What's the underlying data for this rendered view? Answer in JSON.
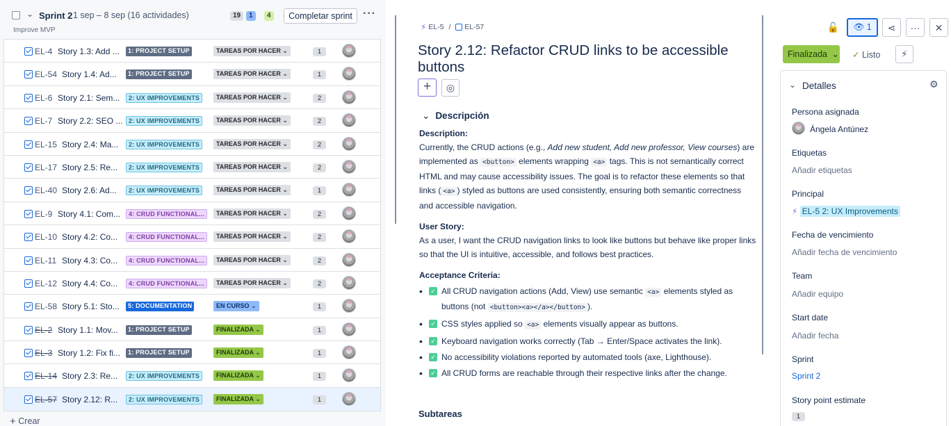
{
  "sprint": {
    "name": "Sprint 2",
    "dates": "1 sep – 8 sep (16 actividades)",
    "goal": "Improve MVP",
    "counts": {
      "todo": "19",
      "in_progress": "1",
      "done": "4"
    },
    "complete_label": "Completar sprint",
    "more": "···"
  },
  "issues": [
    {
      "key": "EL-4",
      "title": "Story 1.3: Add ...",
      "epic": "1: PROJECT SETUP",
      "epic_class": "e1",
      "status": "TAREAS POR HACER",
      "status_class": "todo",
      "points": "1",
      "done": false
    },
    {
      "key": "EL-54",
      "title": "Story 1.4: Ad...",
      "epic": "1: PROJECT SETUP",
      "epic_class": "e1",
      "status": "TAREAS POR HACER",
      "status_class": "todo",
      "points": "1",
      "done": false
    },
    {
      "key": "EL-6",
      "title": "Story 2.1: Sem...",
      "epic": "2: UX IMPROVEMENTS",
      "epic_class": "e2",
      "status": "TAREAS POR HACER",
      "status_class": "todo",
      "points": "2",
      "done": false
    },
    {
      "key": "EL-7",
      "title": "Story 2.2: SEO ...",
      "epic": "2: UX IMPROVEMENTS",
      "epic_class": "e2",
      "status": "TAREAS POR HACER",
      "status_class": "todo",
      "points": "2",
      "done": false
    },
    {
      "key": "EL-15",
      "title": "Story 2.4: Ma...",
      "epic": "2: UX IMPROVEMENTS",
      "epic_class": "e2",
      "status": "TAREAS POR HACER",
      "status_class": "todo",
      "points": "2",
      "done": false
    },
    {
      "key": "EL-17",
      "title": "Story 2.5: Re...",
      "epic": "2: UX IMPROVEMENTS",
      "epic_class": "e2",
      "status": "TAREAS POR HACER",
      "status_class": "todo",
      "points": "2",
      "done": false
    },
    {
      "key": "EL-40",
      "title": "Story 2.6: Ad...",
      "epic": "2: UX IMPROVEMENTS",
      "epic_class": "e2",
      "status": "TAREAS POR HACER",
      "status_class": "todo",
      "points": "1",
      "done": false
    },
    {
      "key": "EL-9",
      "title": "Story 4.1: Com...",
      "epic": "4: CRUD FUNCTIONAL...",
      "epic_class": "e4",
      "status": "TAREAS POR HACER",
      "status_class": "todo",
      "points": "2",
      "done": false
    },
    {
      "key": "EL-10",
      "title": "Story 4.2: Co...",
      "epic": "4: CRUD FUNCTIONAL...",
      "epic_class": "e4",
      "status": "TAREAS POR HACER",
      "status_class": "todo",
      "points": "2",
      "done": false
    },
    {
      "key": "EL-11",
      "title": "Story 4.3: Co...",
      "epic": "4: CRUD FUNCTIONAL...",
      "epic_class": "e4",
      "status": "TAREAS POR HACER",
      "status_class": "todo",
      "points": "2",
      "done": false
    },
    {
      "key": "EL-12",
      "title": "Story 4.4: Co...",
      "epic": "4: CRUD FUNCTIONAL...",
      "epic_class": "e4",
      "status": "TAREAS POR HACER",
      "status_class": "todo",
      "points": "2",
      "done": false
    },
    {
      "key": "EL-58",
      "title": "Story 5.1: Sto...",
      "epic": "5: DOCUMENTATION",
      "epic_class": "e5",
      "status": "EN CURSO",
      "status_class": "prog",
      "points": "1",
      "done": false
    },
    {
      "key": "EL-2",
      "title": "Story 1.1: Mov...",
      "epic": "1: PROJECT SETUP",
      "epic_class": "e1",
      "status": "FINALIZADA",
      "status_class": "done",
      "points": "1",
      "done": true
    },
    {
      "key": "EL-3",
      "title": "Story 1.2: Fix fi...",
      "epic": "1: PROJECT SETUP",
      "epic_class": "e1",
      "status": "FINALIZADA",
      "status_class": "done",
      "points": "1",
      "done": true
    },
    {
      "key": "EL-14",
      "title": "Story 2.3: Re...",
      "epic": "2: UX IMPROVEMENTS",
      "epic_class": "e2",
      "status": "FINALIZADA",
      "status_class": "done",
      "points": "1",
      "done": true
    },
    {
      "key": "EL-57",
      "title": "Story 2.12: R...",
      "epic": "2: UX IMPROVEMENTS",
      "epic_class": "e2",
      "status": "FINALIZADA",
      "status_class": "done",
      "points": "1",
      "done": true,
      "selected": true
    }
  ],
  "create_label": "Crear",
  "detail": {
    "breadcrumb_parent": "EL-5",
    "breadcrumb_sep": "/",
    "breadcrumb_current": "EL-57",
    "title": "Story 2.12: Refactor CRUD links to be accessible buttons",
    "section_description": "Descripción",
    "subtasks": "Subtareas"
  },
  "panel": {
    "watch_count": "1",
    "status": "Finalizada",
    "resolution": "Listo",
    "details_title": "Detalles",
    "fields": {
      "assignee_label": "Persona asignada",
      "assignee": "Ángela Antúnez",
      "labels_label": "Etiquetas",
      "labels": "Añadir etiquetas",
      "parent_label": "Principal",
      "parent": "EL-5 2: UX Improvements",
      "due_label": "Fecha de vencimiento",
      "due": "Añadir fecha de vencimiento",
      "team_label": "Team",
      "team": "Añadir equipo",
      "start_label": "Start date",
      "start": "Añadir fecha",
      "sprint_label": "Sprint",
      "sprint": "Sprint 2",
      "spe_label": "Story point estimate",
      "spe": "1"
    }
  },
  "colors": {
    "accent": "#1868db",
    "done": "#94c748",
    "epic_purple": "#8270db"
  }
}
